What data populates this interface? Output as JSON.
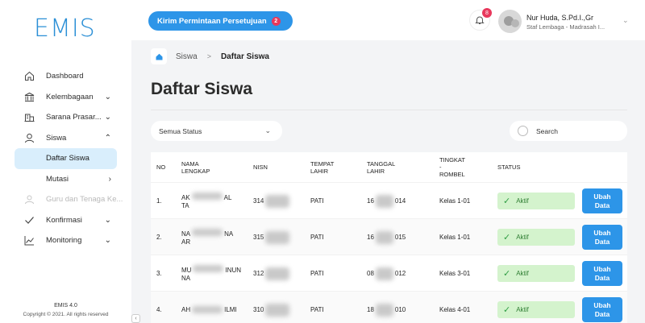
{
  "app": {
    "logo": "EMIS",
    "footer_title": "EMIS 4.0",
    "footer_copy": "Copyright © 2021. All rights reserved"
  },
  "sidebar": {
    "items": [
      {
        "label": "Dashboard",
        "icon": "home-icon",
        "chevron": ""
      },
      {
        "label": "Kelembagaan",
        "icon": "institution-icon",
        "chevron": "down"
      },
      {
        "label": "Sarana Prasar...",
        "icon": "building-icon",
        "chevron": "down"
      },
      {
        "label": "Siswa",
        "icon": "user-icon",
        "chevron": "up"
      },
      {
        "label": "Daftar Siswa",
        "sub": true,
        "active": true
      },
      {
        "label": "Mutasi",
        "sub": true,
        "chevron": "right"
      },
      {
        "label": "Guru dan Tenaga Ke...",
        "icon": "teacher-icon",
        "muted": true
      },
      {
        "label": "Konfirmasi",
        "icon": "check-icon",
        "chevron": "down"
      },
      {
        "label": "Monitoring",
        "icon": "chart-icon",
        "chevron": "down"
      }
    ]
  },
  "topbar": {
    "request_button": "Kirim Permintaan Persetujuan",
    "request_badge": "2",
    "notification_count": "8",
    "user_name": "Nur Huda, S.Pd.I.,Gr",
    "user_role": "Staf Lembaga - Madrasah I..."
  },
  "breadcrumb": {
    "level1": "Siswa",
    "separator": ">",
    "current": "Daftar Siswa"
  },
  "page_title": "Daftar Siswa",
  "filters": {
    "status": "Semua Status",
    "search_placeholder": "Search"
  },
  "table": {
    "headers": {
      "no": "NO",
      "name": "NAMA\nLENGKAP",
      "nisn": "NISN",
      "birthplace": "TEMPAT\nLAHIR",
      "birthdate": "TANGGAL\nLAHIR",
      "grade": "TINGKAT\n-\nROMBEL",
      "status": "STATUS"
    },
    "rows": [
      {
        "no": "1.",
        "name_a": "AK",
        "name_b": "AL",
        "name_c": "TA",
        "nisn": "314",
        "place": "PATI",
        "date_a": "16",
        "date_b": "014",
        "grade": "Kelas 1-01",
        "status": "Aktif",
        "action": "Ubah\nData"
      },
      {
        "no": "2.",
        "name_a": "NA",
        "name_b": "NA",
        "name_c": "AR",
        "nisn": "315",
        "place": "PATI",
        "date_a": "16",
        "date_b": "015",
        "grade": "Kelas 1-01",
        "status": "Aktif",
        "action": "Ubah\nData"
      },
      {
        "no": "3.",
        "name_a": "MU",
        "name_b": "INUN",
        "name_c": "NA",
        "nisn": "312",
        "place": "PATI",
        "date_a": "08",
        "date_b": "012",
        "grade": "Kelas 3-01",
        "status": "Aktif",
        "action": "Ubah\nData"
      },
      {
        "no": "4.",
        "name_a": "AH",
        "name_b": "ILMI",
        "name_c": "",
        "nisn": "310",
        "place": "PATI",
        "date_a": "18",
        "date_b": "010",
        "grade": "Kelas 4-01",
        "status": "Aktif",
        "action": "Ubah\nData"
      }
    ]
  },
  "colors": {
    "primary": "#2d95e8",
    "badge": "#e8385c",
    "active_status_bg": "#d4f3cd",
    "sidebar_active": "#d9eefc"
  }
}
